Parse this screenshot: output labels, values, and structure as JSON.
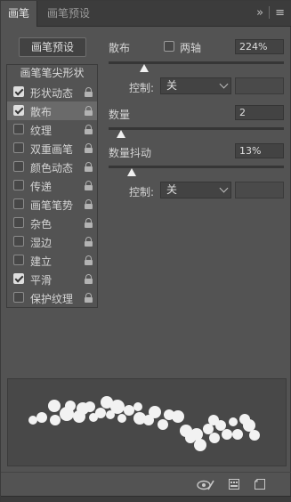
{
  "tabs": [
    {
      "label": "画笔",
      "active": true
    },
    {
      "label": "画笔预设",
      "active": false
    }
  ],
  "tab_icons": {
    "collapse": "»",
    "menu": "≡"
  },
  "preset_button": "画笔预设",
  "list_header": "画笔笔尖形状",
  "items": [
    {
      "label": "形状动态",
      "checked": true,
      "selected": false
    },
    {
      "label": "散布",
      "checked": true,
      "selected": true
    },
    {
      "label": "纹理",
      "checked": false,
      "selected": false
    },
    {
      "label": "双重画笔",
      "checked": false,
      "selected": false
    },
    {
      "label": "颜色动态",
      "checked": false,
      "selected": false
    },
    {
      "label": "传递",
      "checked": false,
      "selected": false
    },
    {
      "label": "画笔笔势",
      "checked": false,
      "selected": false
    },
    {
      "label": "杂色",
      "checked": false,
      "selected": false
    },
    {
      "label": "湿边",
      "checked": false,
      "selected": false
    },
    {
      "label": "建立",
      "checked": false,
      "selected": false
    },
    {
      "label": "平滑",
      "checked": true,
      "selected": false
    },
    {
      "label": "保护纹理",
      "checked": false,
      "selected": false
    }
  ],
  "scatter": {
    "label": "散布",
    "both_axes_label": "两轴",
    "value": "224%",
    "slider_fraction": 0.224,
    "control_label": "控制:",
    "control_value": "关"
  },
  "count": {
    "label": "数量",
    "value": "2",
    "slider_fraction": 0.07
  },
  "count_jitter": {
    "label": "数量抖动",
    "value": "13%",
    "slider_fraction": 0.13,
    "control_label": "控制:",
    "control_value": "关"
  },
  "colors": {
    "panel_bg": "#535353",
    "tab_bar": "#3c3c3c",
    "selected_row": "#6a6a6a",
    "preview_bg": "#484848",
    "dot": "#f2f2f2"
  },
  "footer_icons": [
    "eye-brush-icon",
    "grid-panel-icon",
    "new-preset-icon"
  ]
}
